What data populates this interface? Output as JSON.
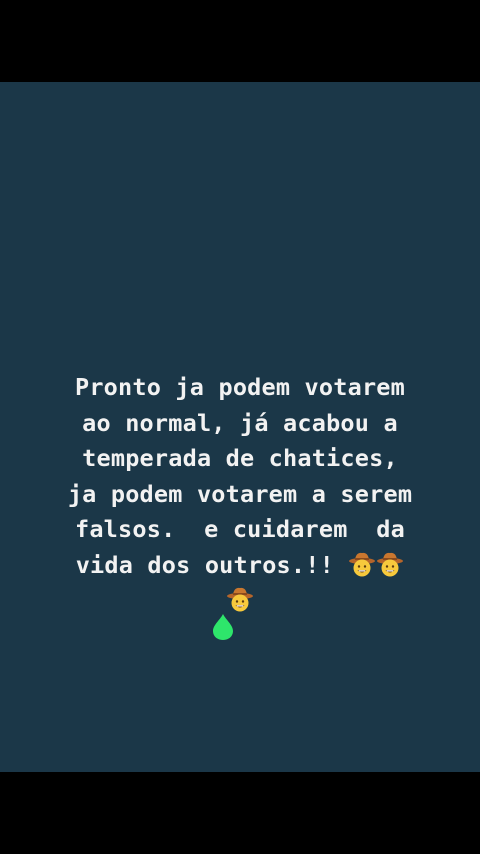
{
  "story": {
    "lines": [
      "Pronto ja podem votarem",
      "ao normal, já acabou a",
      "temperada de chatices,",
      "ja podem votarem a serem",
      "falsos.  e cuidarem  da",
      "vida dos outros.!! "
    ],
    "emoji_name": "cowboy-hat-face-emoji",
    "emoji_count": 3
  },
  "sticker": {
    "icon": "green-drop-icon",
    "color": "#2ee66b"
  },
  "colors": {
    "background": "#1b3748",
    "text": "#f2f2f2",
    "letterbox": "#000000"
  }
}
